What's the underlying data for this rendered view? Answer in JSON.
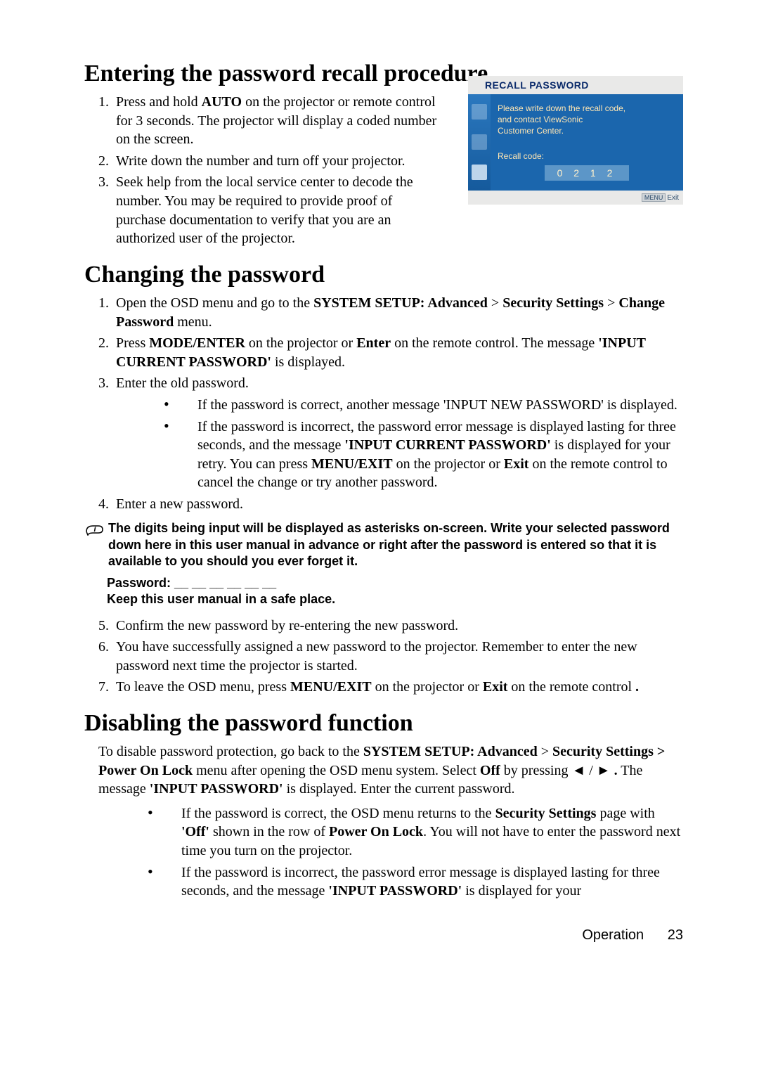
{
  "section1": {
    "title": "Entering the password recall procedure",
    "items": [
      {
        "n": "1.",
        "t": "Press and hold <b>AUTO</b> on the projector or remote control for 3 seconds. The projector will display a coded number on the screen."
      },
      {
        "n": "2.",
        "t": "Write down the number and turn off your projector."
      },
      {
        "n": "3.",
        "t": "Seek help from the local service center to decode the number. You may be required to provide proof of purchase documentation to verify that you are an authorized user of the projector."
      }
    ]
  },
  "osd": {
    "title": "RECALL PASSWORD",
    "msg_line1": "Please write down the recall code,",
    "msg_line2": "and contact ViewSonic",
    "msg_line3": "Customer Center.",
    "recall_label": "Recall code:",
    "recall_code": "0 2 1 2",
    "menu_btn": "MENU",
    "exit_label": "Exit"
  },
  "section2": {
    "title": "Changing the password",
    "items": [
      {
        "n": "1.",
        "t": "Open the OSD menu and go to the <b>SYSTEM SETUP: Advanced</b> > <b>Security Settings</b> > <b>Change Password</b> menu."
      },
      {
        "n": "2.",
        "t": "Press <b>MODE/ENTER</b> on the projector or <b>Enter</b> on the remote control. The message <b>'INPUT CURRENT PASSWORD'</b> is displayed."
      },
      {
        "n": "3.",
        "t": "Enter the old password."
      }
    ],
    "bullets3": [
      "If the password is correct, another message 'INPUT NEW PASSWORD' is displayed.",
      "If the password is incorrect, the password error message is displayed lasting for three seconds, and the message <b>'INPUT CURRENT PASSWORD'</b> is displayed for your retry. You can press <b>MENU/EXIT</b> on the projector or <b>Exit</b> on the remote control to cancel the change or try another password."
    ],
    "item4": {
      "n": "4.",
      "t": "Enter a new password."
    },
    "tip": "The digits being input will be displayed as asterisks on-screen. Write your selected password down here in this user manual in advance or right after the password is entered so that it is available to you should you ever forget it.",
    "password_line": "Password: __ __ __ __ __ __",
    "keep_line": "Keep this user manual in a safe place.",
    "items567": [
      {
        "n": "5.",
        "t": "Confirm the new password by re-entering the new password."
      },
      {
        "n": "6.",
        "t": "You have successfully assigned a new password to the projector. Remember to enter the new password next time the projector is started."
      },
      {
        "n": "7.",
        "t": "To leave the OSD menu, press <b>MENU/EXIT</b> on the projector or <b>Exit</b> on the remote control <b>.</b>"
      }
    ]
  },
  "section3": {
    "title": "Disabling the password function",
    "para": "To disable password protection, go back to the <b>SYSTEM SETUP: Advanced</b> > <b>Security Settings &gt; Power On Lock</b> menu after opening the OSD menu system. Select <b>Off</b> by pressing <span class='arrow'>◄</span> / <span class='arrow'>►</span> <b>.</b> The message <b>'INPUT PASSWORD'</b> is displayed. Enter the current password.",
    "bullets": [
      "If the password is correct, the OSD menu returns to the <b>Security Settings</b> page with <b>'Off'</b> shown in the row of <b>Power On Lock</b>. You will not have to enter the password next time you turn on the projector.",
      "If the password is incorrect, the password error message is displayed lasting for three seconds, and the message <b>'INPUT PASSWORD'</b> is displayed for your"
    ]
  },
  "footer": {
    "section_label": "Operation",
    "page_number": "23"
  }
}
